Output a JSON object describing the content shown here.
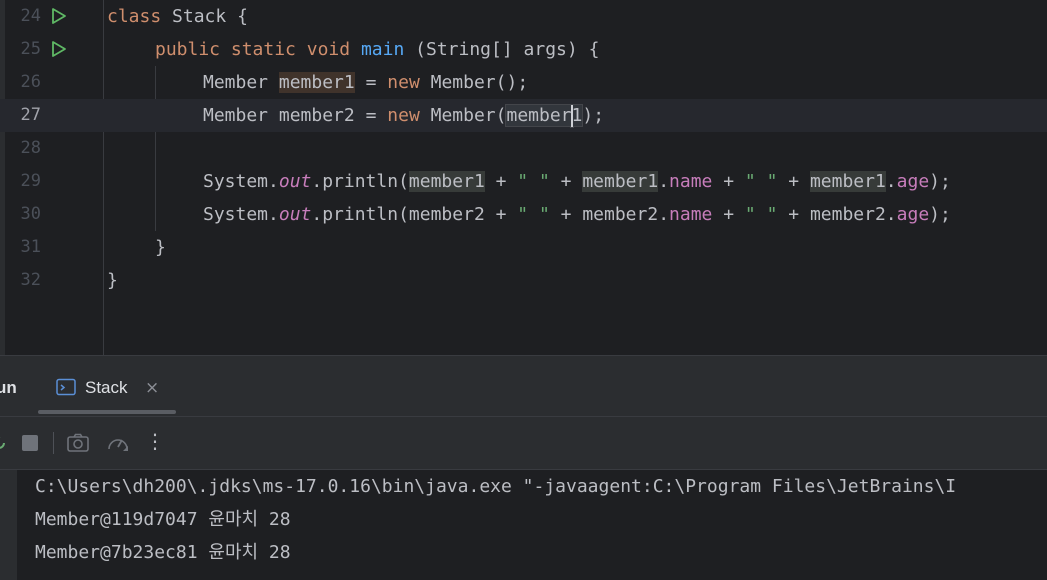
{
  "editor": {
    "lines": [
      {
        "num": "24",
        "run": true,
        "tokens": {
          "kw_class": "class",
          "name": "Stack",
          "brace": "{"
        }
      },
      {
        "num": "25",
        "run": true,
        "tokens": {
          "kw_public": "public",
          "kw_static": "static",
          "kw_void": "void",
          "fn_main": "main",
          "params": "(String[] args)",
          "brace": "{"
        }
      },
      {
        "num": "26",
        "tokens": {
          "type": "Member",
          "var": "member1",
          "eq": "=",
          "kw_new": "new",
          "ctor": "Member();"
        }
      },
      {
        "num": "27",
        "current": true,
        "tokens": {
          "type": "Member",
          "var": "member2",
          "eq": "=",
          "kw_new": "new",
          "ctor_open": "Member(",
          "arg_a": "member",
          "arg_b": "1",
          "close": ");"
        }
      },
      {
        "num": "28"
      },
      {
        "num": "29",
        "tokens": {
          "system": "System.",
          "out": "out",
          "println": ".println(",
          "m_a": "member1",
          "plus1": " + ",
          "s1": "\" \"",
          "plus2": " + ",
          "m_b": "member1",
          "dot1": ".",
          "name": "name",
          "plus3": " + ",
          "s2": "\" \"",
          "plus4": " + ",
          "m_c": "member1",
          "dot2": ".",
          "age": "age",
          "end": ");"
        }
      },
      {
        "num": "30",
        "tokens": {
          "system": "System.",
          "out": "out",
          "println": ".println(",
          "m_a": "member2",
          "plus1": " + ",
          "s1": "\" \"",
          "plus2": " + ",
          "m_b": "member2",
          "dot1": ".",
          "name": "name",
          "plus3": " + ",
          "s2": "\" \"",
          "plus4": " + ",
          "m_c": "member2",
          "dot2": ".",
          "age": "age",
          "end": ");"
        }
      },
      {
        "num": "31",
        "tokens": {
          "brace": "}"
        }
      },
      {
        "num": "32",
        "tokens": {
          "brace": "}"
        }
      }
    ]
  },
  "tool_window": {
    "title": "un",
    "tab": {
      "label": "Stack",
      "close": "×"
    },
    "toolbar": [
      "rerun-icon",
      "stop-icon",
      "camera-icon",
      "gauge-icon",
      "more-icon"
    ],
    "more_glyph": "⋮"
  },
  "console": {
    "lines": [
      "C:\\Users\\dh200\\.jdks\\ms-17.0.16\\bin\\java.exe \"-javaagent:C:\\Program Files\\JetBrains\\I",
      "Member@119d7047 윤마치 28",
      "Member@7b23ec81 윤마치 28"
    ]
  },
  "colors": {
    "keyword": "#cf8e6d",
    "function": "#56a8f5",
    "string": "#6aab73",
    "field": "#c77dbb",
    "text": "#bcbec4",
    "background": "#1e1f22",
    "run_icon": "#5fb865"
  }
}
